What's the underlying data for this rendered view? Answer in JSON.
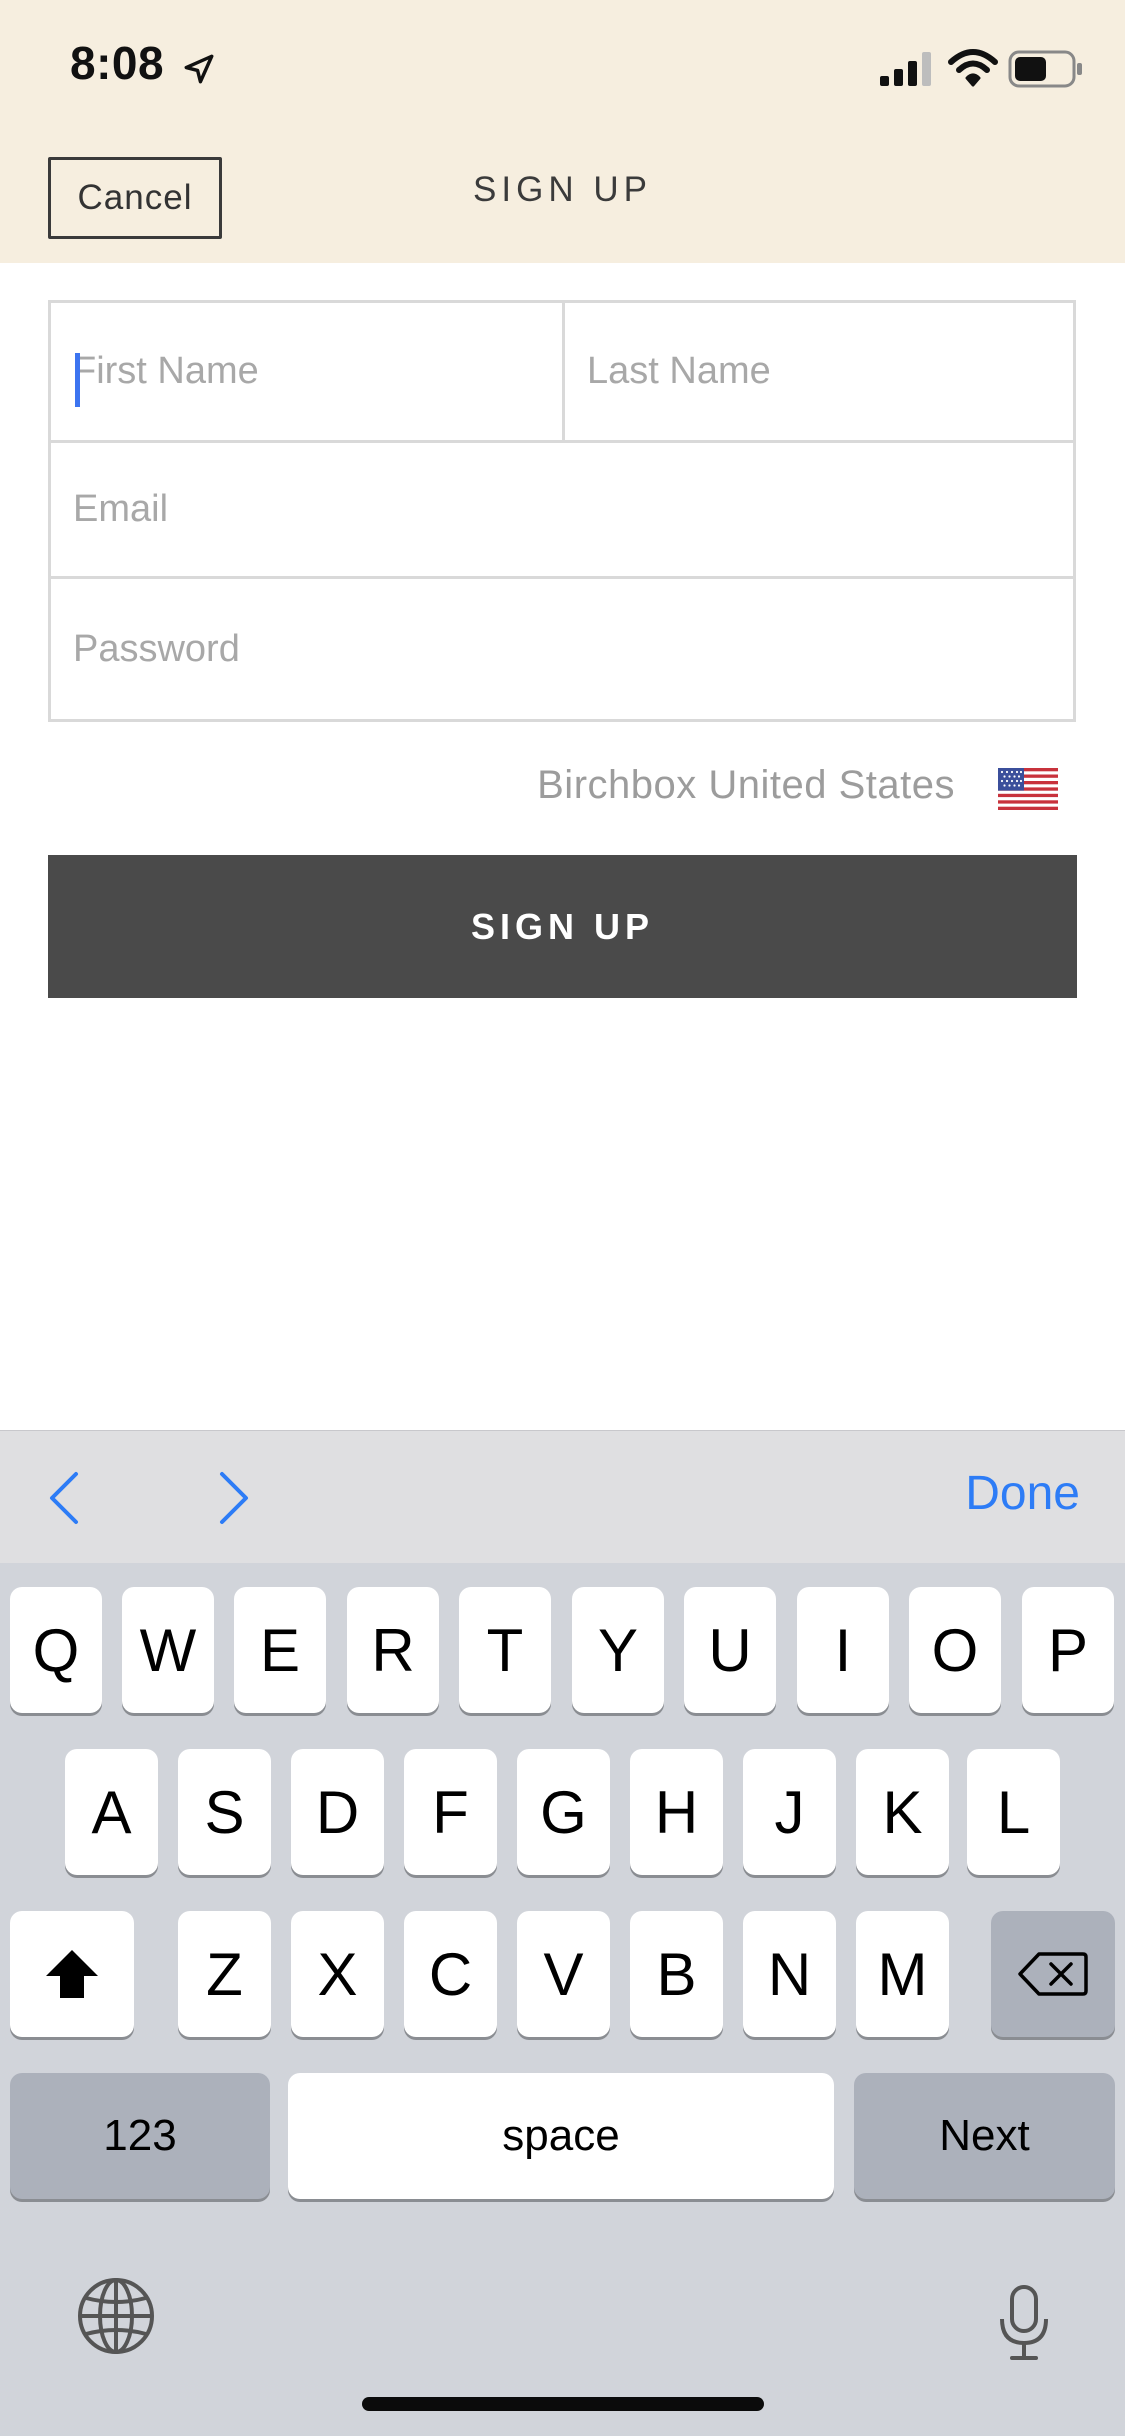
{
  "status_bar": {
    "time": "8:08"
  },
  "nav": {
    "cancel_label": "Cancel",
    "title": "SIGN UP"
  },
  "form": {
    "first_name_placeholder": "First Name",
    "last_name_placeholder": "Last Name",
    "email_placeholder": "Email",
    "password_placeholder": "Password"
  },
  "country": {
    "label": "Birchbox United States",
    "flag": "us-flag-icon"
  },
  "signup_button_label": "SIGN UP",
  "accessory": {
    "done_label": "Done"
  },
  "keyboard": {
    "row1": [
      "Q",
      "W",
      "E",
      "R",
      "T",
      "Y",
      "U",
      "I",
      "O",
      "P"
    ],
    "row2": [
      "A",
      "S",
      "D",
      "F",
      "G",
      "H",
      "J",
      "K",
      "L"
    ],
    "row3": [
      "Z",
      "X",
      "C",
      "V",
      "B",
      "N",
      "M"
    ],
    "numbers_label": "123",
    "space_label": "space",
    "next_label": "Next"
  },
  "colors": {
    "header_bg": "#f6eedf",
    "button_bg": "#4a4a4a",
    "accent": "#2d7cf6",
    "keyboard_bg": "#d1d4da"
  }
}
